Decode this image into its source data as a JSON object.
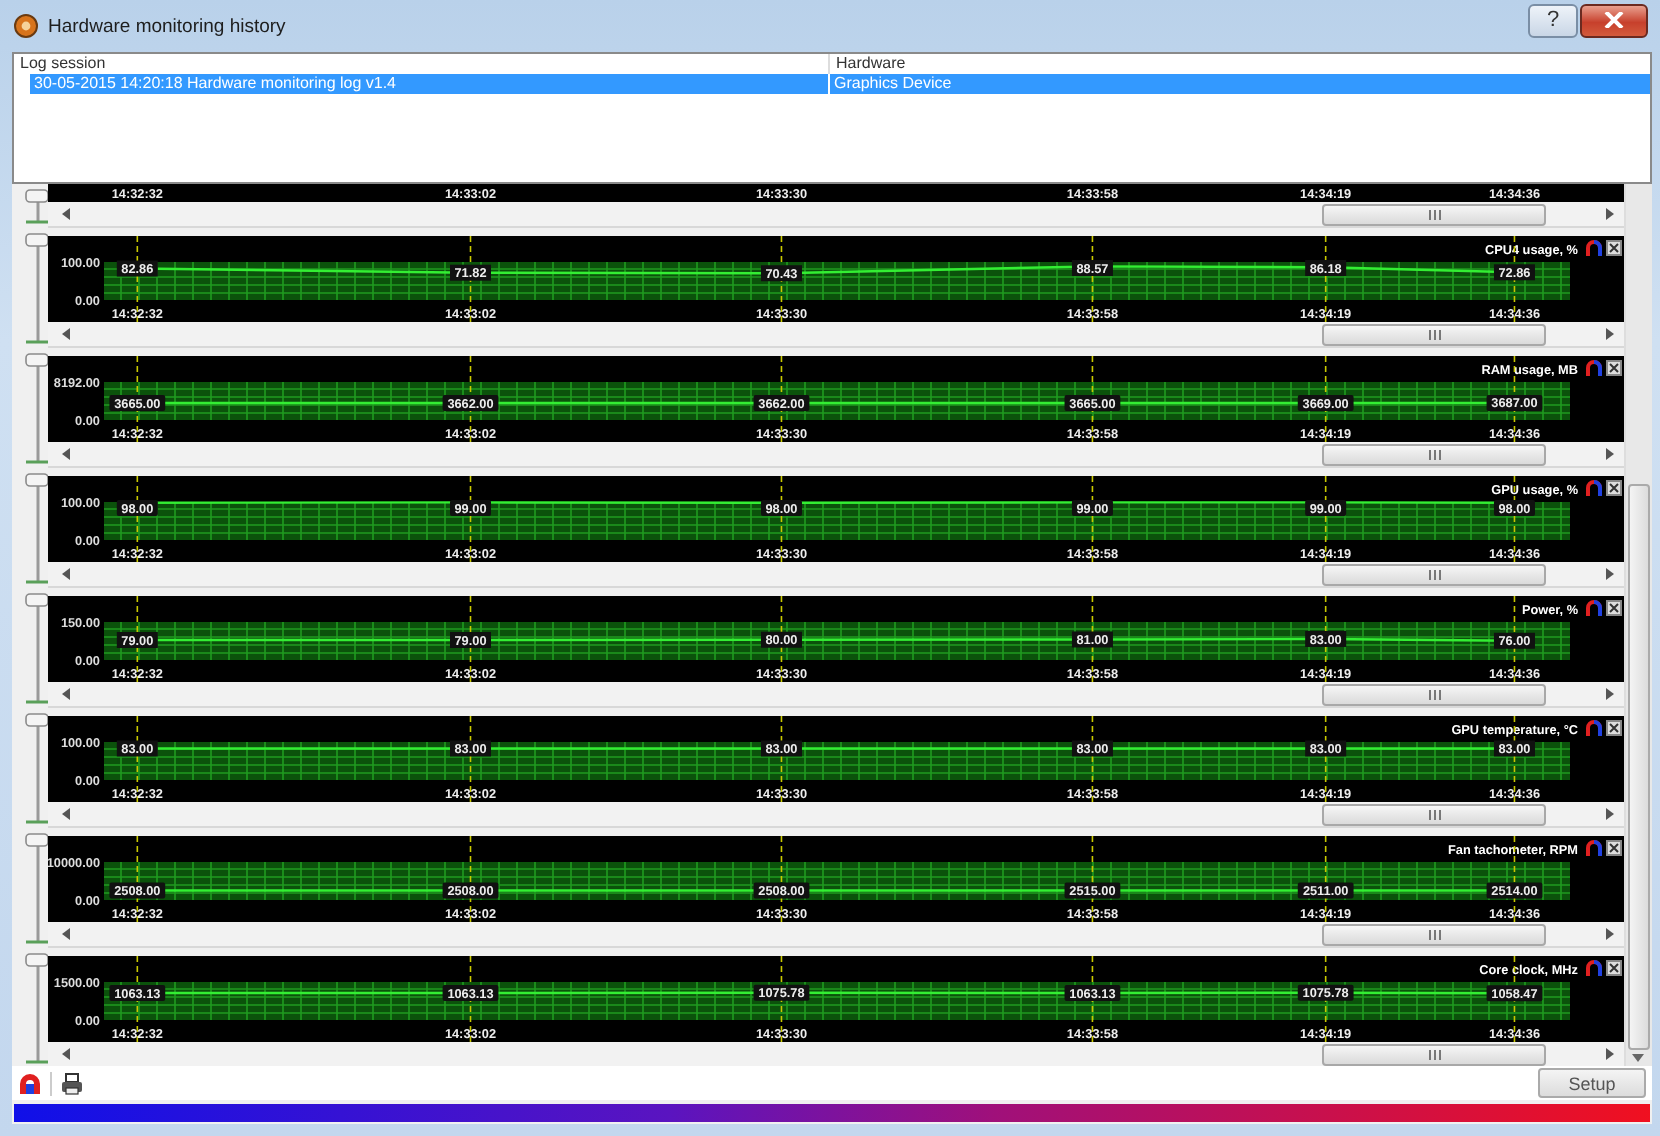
{
  "window": {
    "title": "Hardware monitoring history",
    "help_button": "?"
  },
  "log_table": {
    "columns": [
      "Log session",
      "Hardware"
    ],
    "rows": [
      {
        "cells": [
          "30-05-2015 14:20:18 Hardware monitoring log v1.4",
          "Graphics Device"
        ],
        "selected": true
      }
    ]
  },
  "partial_graph": {
    "time_labels": [
      "14:32:32",
      "14:33:02",
      "14:33:30",
      "14:33:58",
      "14:34:19",
      "14:34:36"
    ]
  },
  "graphs": [
    {
      "chart_data": {
        "type": "line",
        "title": "CPU4 usage, %",
        "categories": [
          "14:32:32",
          "14:33:02",
          "14:33:30",
          "14:33:58",
          "14:34:19",
          "14:34:36"
        ],
        "ylim": [
          0,
          100
        ],
        "yticks": [
          {
            "value": 0,
            "label": "0.00"
          },
          {
            "value": 100,
            "label": "100.00"
          }
        ],
        "grid": true,
        "series": [
          {
            "color": "#33ee33",
            "marker": "square",
            "values": [
              82.86,
              71.82,
              70.43,
              88.57,
              86.18,
              72.86
            ]
          }
        ],
        "value_labels": [
          "82.86",
          "71.82",
          "70.43",
          "88.57",
          "86.18",
          "72.86"
        ]
      }
    },
    {
      "chart_data": {
        "type": "line",
        "title": "RAM usage, MB",
        "categories": [
          "14:32:32",
          "14:33:02",
          "14:33:30",
          "14:33:58",
          "14:34:19",
          "14:34:36"
        ],
        "ylim": [
          0,
          8192
        ],
        "yticks": [
          {
            "value": 0,
            "label": "0.00"
          },
          {
            "value": 8192,
            "label": "8192.00"
          }
        ],
        "grid": true,
        "series": [
          {
            "color": "#33ee33",
            "values": [
              3665,
              3662,
              3662,
              3665,
              3669,
              3687
            ]
          }
        ],
        "value_labels": [
          "3665.00",
          "3662.00",
          "3662.00",
          "3665.00",
          "3669.00",
          "3687.00"
        ]
      }
    },
    {
      "chart_data": {
        "type": "line",
        "title": "GPU usage, %",
        "categories": [
          "14:32:32",
          "14:33:02",
          "14:33:30",
          "14:33:58",
          "14:34:19",
          "14:34:36"
        ],
        "ylim": [
          0,
          100
        ],
        "yticks": [
          {
            "value": 0,
            "label": "0.00"
          },
          {
            "value": 100,
            "label": "100.00"
          }
        ],
        "grid": true,
        "series": [
          {
            "color": "#33ee33",
            "values": [
              98,
              99,
              98,
              99,
              99,
              98
            ]
          }
        ],
        "value_labels": [
          "98.00",
          "99.00",
          "98.00",
          "99.00",
          "99.00",
          "98.00"
        ]
      }
    },
    {
      "chart_data": {
        "type": "line",
        "title": "Power, %",
        "categories": [
          "14:32:32",
          "14:33:02",
          "14:33:30",
          "14:33:58",
          "14:34:19",
          "14:34:36"
        ],
        "ylim": [
          0,
          150
        ],
        "yticks": [
          {
            "value": 0,
            "label": "0.00"
          },
          {
            "value": 150,
            "label": "150.00"
          }
        ],
        "grid": true,
        "series": [
          {
            "color": "#33ee33",
            "marker": "square",
            "values": [
              79,
              79,
              80,
              81,
              83,
              76
            ]
          }
        ],
        "value_labels": [
          "79.00",
          "79.00",
          "80.00",
          "81.00",
          "83.00",
          "76.00"
        ]
      }
    },
    {
      "chart_data": {
        "type": "line",
        "title": "GPU temperature, °C",
        "categories": [
          "14:32:32",
          "14:33:02",
          "14:33:30",
          "14:33:58",
          "14:34:19",
          "14:34:36"
        ],
        "ylim": [
          0,
          100
        ],
        "yticks": [
          {
            "value": 0,
            "label": "0.00"
          },
          {
            "value": 100,
            "label": "100.00"
          }
        ],
        "grid": true,
        "series": [
          {
            "color": "#33ee33",
            "marker": "square",
            "values": [
              83,
              83,
              83,
              83,
              83,
              83
            ]
          }
        ],
        "value_labels": [
          "83.00",
          "83.00",
          "83.00",
          "83.00",
          "83.00",
          "83.00"
        ]
      }
    },
    {
      "chart_data": {
        "type": "line",
        "title": "Fan tachometer, RPM",
        "categories": [
          "14:32:32",
          "14:33:02",
          "14:33:30",
          "14:33:58",
          "14:34:19",
          "14:34:36"
        ],
        "ylim": [
          0,
          10000
        ],
        "yticks": [
          {
            "value": 0,
            "label": "0.00"
          },
          {
            "value": 10000,
            "label": "10000.00"
          }
        ],
        "grid": true,
        "series": [
          {
            "color": "#33ee33",
            "values": [
              2508,
              2508,
              2508,
              2515,
              2511,
              2514
            ]
          }
        ],
        "value_labels": [
          "2508.00",
          "2508.00",
          "2508.00",
          "2515.00",
          "2511.00",
          "2514.00"
        ]
      }
    },
    {
      "chart_data": {
        "type": "line",
        "title": "Core clock, MHz",
        "categories": [
          "14:32:32",
          "14:33:02",
          "14:33:30",
          "14:33:58",
          "14:34:19",
          "14:34:36"
        ],
        "ylim": [
          0,
          1500
        ],
        "yticks": [
          {
            "value": 0,
            "label": "0.00"
          },
          {
            "value": 1500,
            "label": "1500.00"
          }
        ],
        "grid": true,
        "series": [
          {
            "color": "#33ee33",
            "values": [
              1063.13,
              1063.13,
              1075.78,
              1063.13,
              1075.78,
              1058.47
            ]
          }
        ],
        "value_labels": [
          "1063.13",
          "1063.13",
          "1075.78",
          "1063.13",
          "1075.78",
          "1058.47"
        ]
      }
    }
  ],
  "setup_button": "Setup"
}
